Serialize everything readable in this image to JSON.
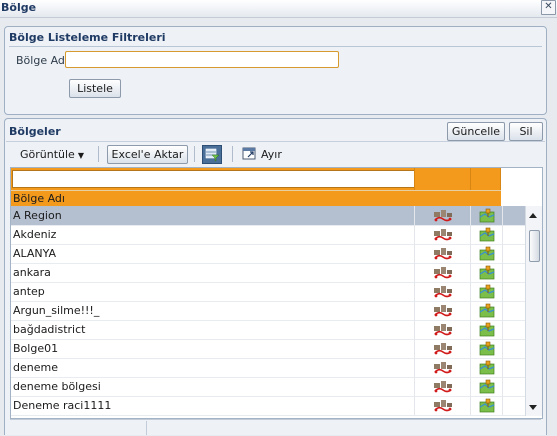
{
  "window": {
    "title": "Bölge",
    "close_glyph": "✕"
  },
  "filter_panel": {
    "title": "Bölge Listeleme Filtreleri",
    "field_label": "Bölge Adı",
    "field_value": "",
    "list_button": "Listele"
  },
  "regions_panel": {
    "title": "Bölgeler",
    "update_button": "Güncelle",
    "delete_button": "Sil",
    "toolbar": {
      "view_menu": "Görüntüle",
      "excel_button": "Excel'e Aktar",
      "detach_label": "Ayır"
    },
    "grid": {
      "filter_value": "",
      "column_header": "Bölge Adı",
      "selected_index": 0,
      "rows": [
        "A Region",
        "Akdeniz",
        "ALANYA",
        "ankara",
        "antep",
        "Argun_silme!!!_",
        "bağdadistrict",
        "Bolge01",
        "deneme",
        "deneme bölgesi",
        "Deneme raci1111"
      ],
      "row_icons": {
        "edit": "map-route-icon",
        "detail": "map-pin-icon"
      }
    }
  }
}
